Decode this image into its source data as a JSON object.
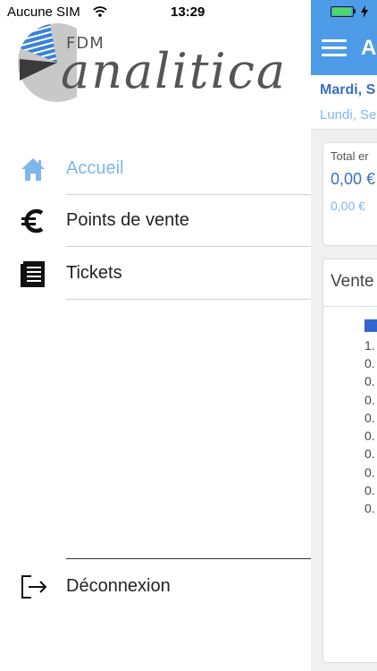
{
  "status_bar": {
    "carrier": "Aucune SIM",
    "time": "13:29"
  },
  "logo": {
    "small_text": "FDM",
    "wordmark": "analitica"
  },
  "menu": {
    "items": [
      {
        "label": "Accueil",
        "icon": "home-icon",
        "active": true
      },
      {
        "label": "Points de vente",
        "icon": "euro-icon",
        "active": false
      },
      {
        "label": "Tickets",
        "icon": "receipt-icon",
        "active": false
      }
    ],
    "logout_label": "Déconnexion",
    "logout_icon": "logout-icon"
  },
  "app": {
    "header_title": "Ac",
    "date_primary": "Mardi, S",
    "date_secondary": "Lundi, Se",
    "card_total_label": "Total er",
    "card_total_value": "0,00 €",
    "card_total_compare": "0,00 €",
    "card_sales_title": "Vente",
    "axis_ticks": [
      "1.",
      "0.",
      "0.",
      "0.",
      "0.",
      "0.",
      "0.",
      "0.",
      "0.",
      "0."
    ]
  },
  "colors": {
    "accent": "#4e9be8",
    "active_menu": "#7fb6ee",
    "date_primary": "#3b6fc4"
  }
}
